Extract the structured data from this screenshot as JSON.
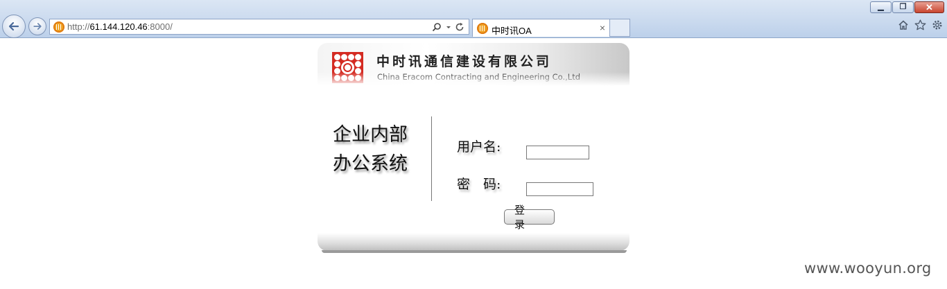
{
  "browser": {
    "url_scheme": "http://",
    "url_host": "61.144.120.46",
    "url_port": ":8000/",
    "tab_title": "中时讯OA",
    "tab_close": "×",
    "icons": [
      "back-icon",
      "forward-icon",
      "search-icon",
      "dropdown-icon",
      "refresh-icon",
      "home-icon",
      "favorites-star-icon",
      "settings-gear-icon"
    ],
    "window_buttons": {
      "minimize": "▁",
      "restore": "❐",
      "close": "✕"
    }
  },
  "header": {
    "company_cn": "中时讯通信建设有限公司",
    "company_en": "China Eracom Contracting and Engineering Co.,Ltd",
    "logo_color": "#d42b22"
  },
  "system_title": {
    "line1": "企业内部",
    "line2": "办公系统"
  },
  "form": {
    "username_label": "用户名:",
    "username_value": "",
    "password_label": "密　码:",
    "password_value": "",
    "login_label": "登 录"
  },
  "watermark": "www.wooyun.org"
}
